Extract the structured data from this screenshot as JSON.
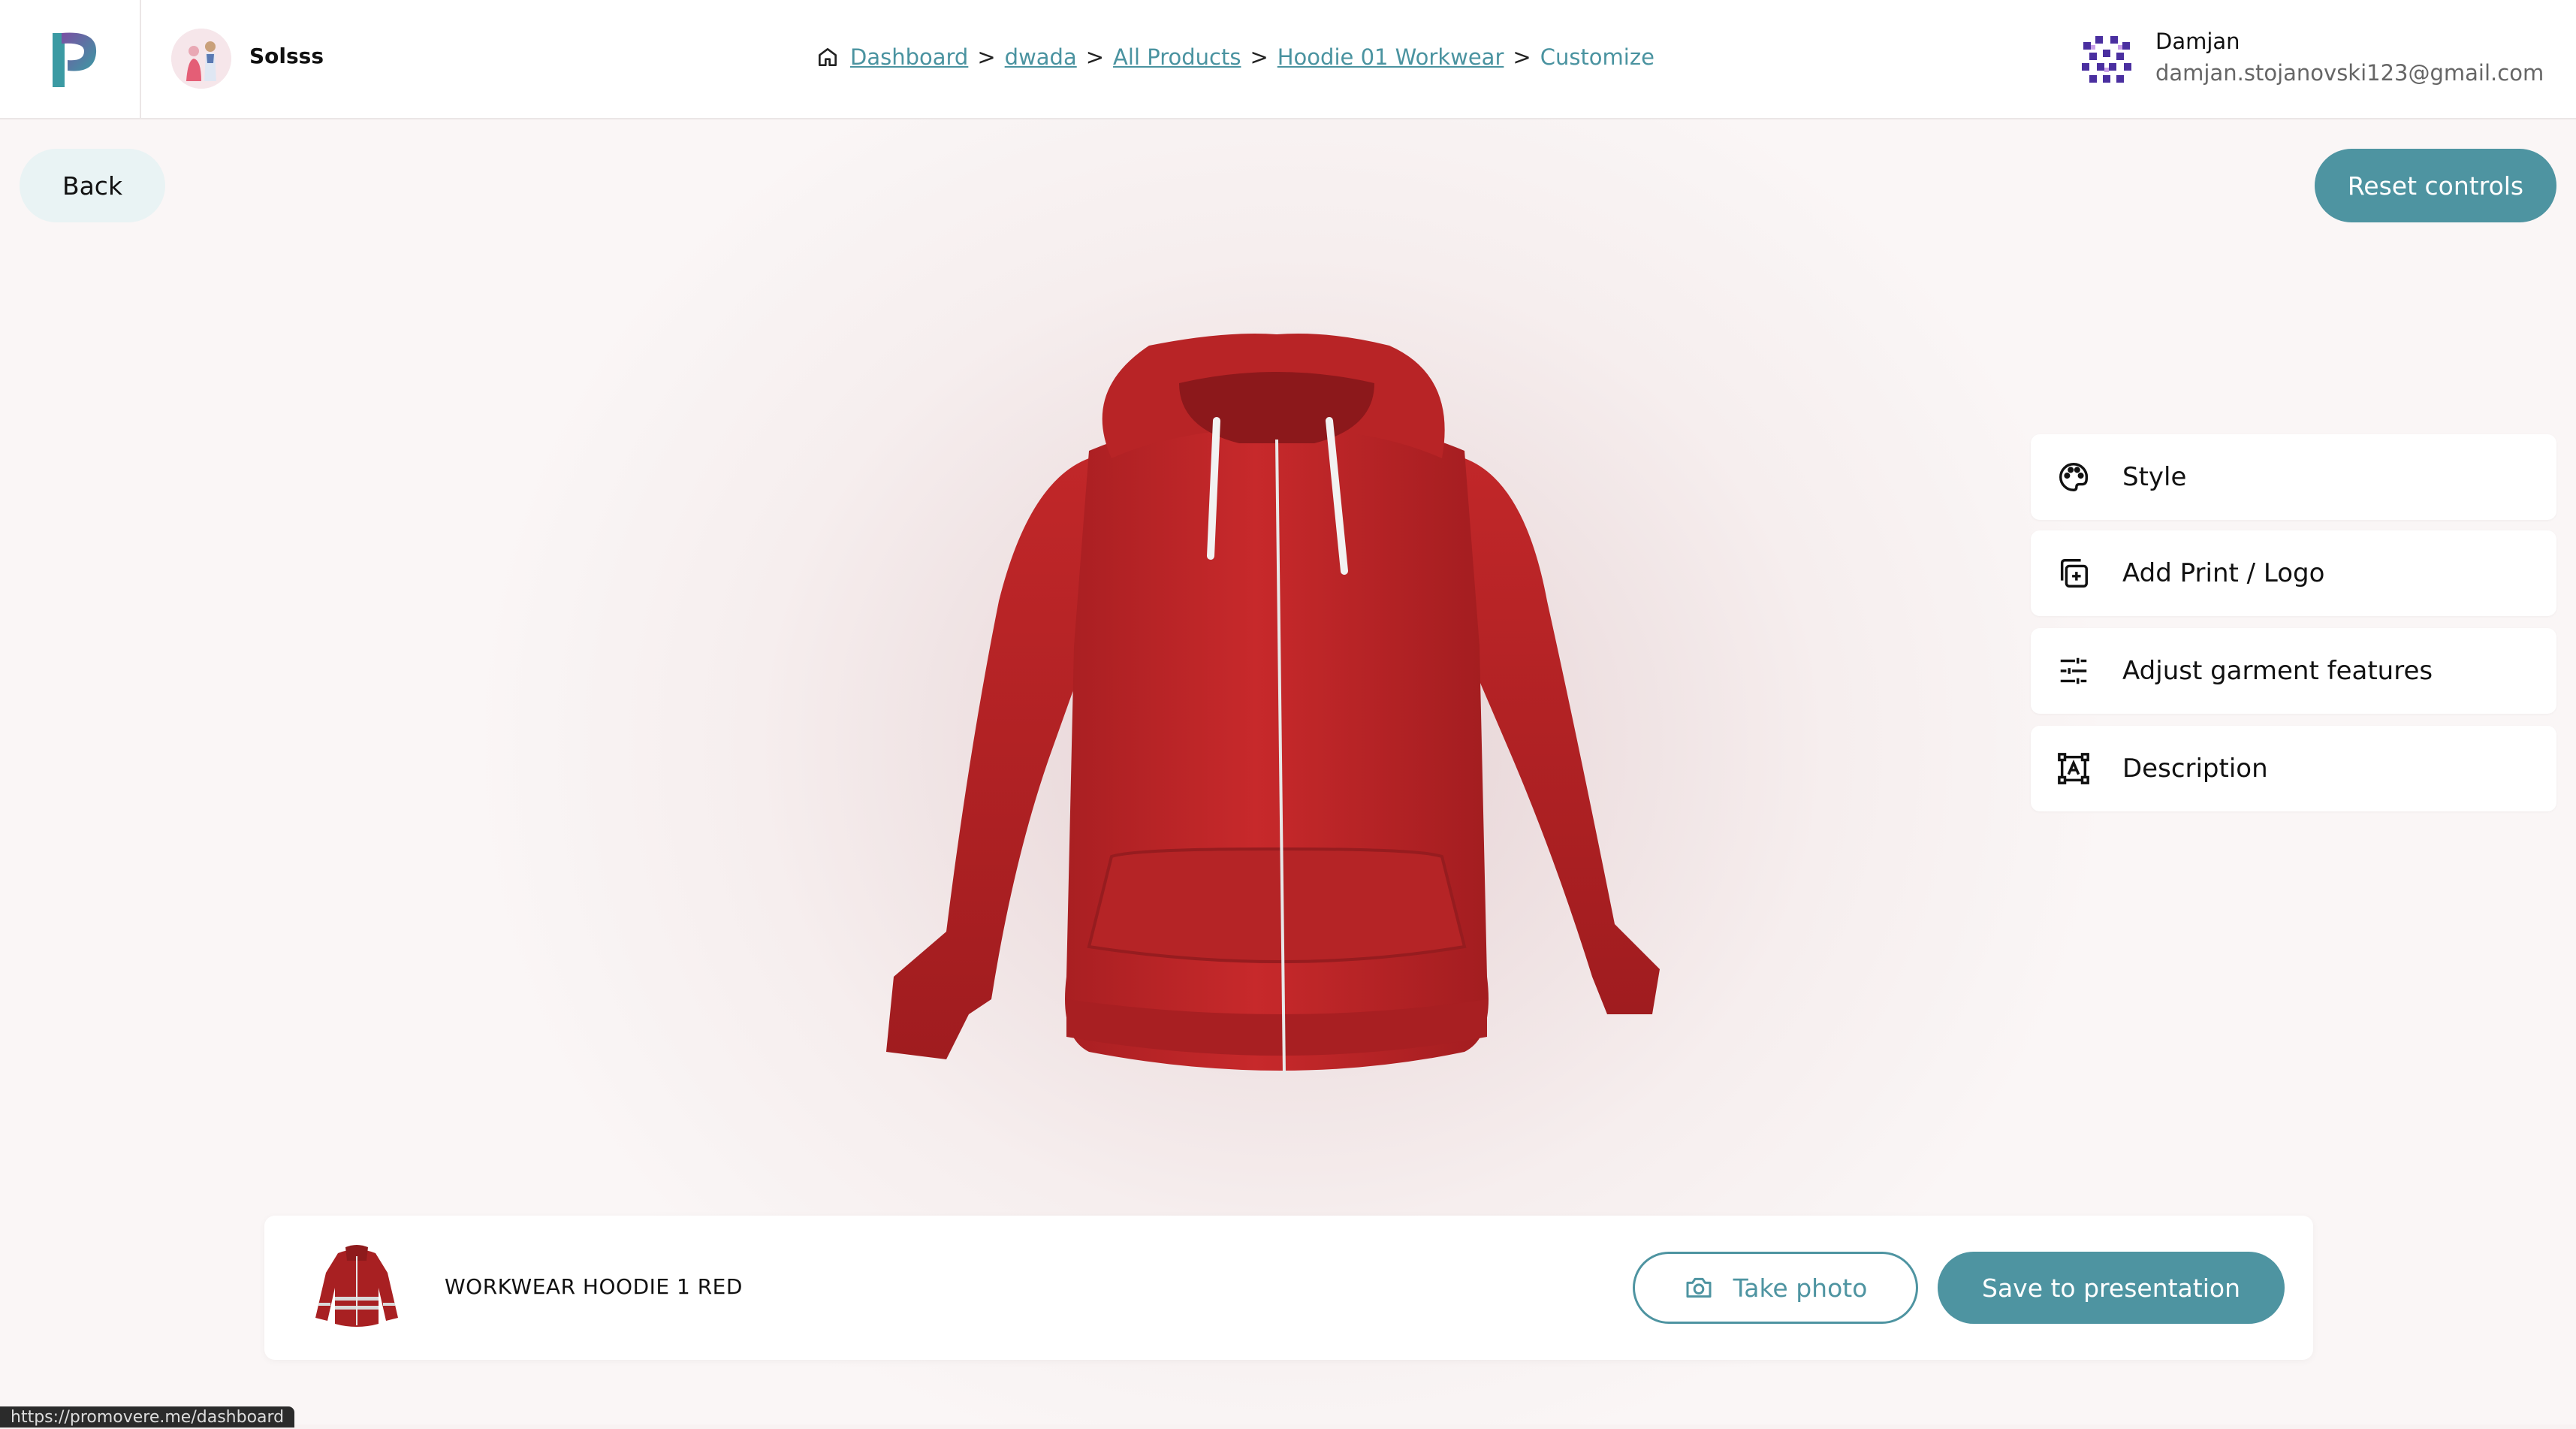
{
  "header": {
    "org_name": "Solsss",
    "breadcrumb": {
      "items": [
        "Dashboard",
        "dwada",
        "All Products",
        "Hoodie 01 Workwear"
      ],
      "current": "Customize",
      "separator": ">"
    },
    "user": {
      "name": "Damjan",
      "email": "damjan.stojanovski123@gmail.com"
    }
  },
  "controls": {
    "back_label": "Back",
    "reset_label": "Reset controls"
  },
  "menu": {
    "items": [
      {
        "label": "Style",
        "icon": "palette-icon"
      },
      {
        "label": "Add Print / Logo",
        "icon": "add-layer-icon"
      },
      {
        "label": "Adjust garment features",
        "icon": "sliders-icon"
      },
      {
        "label": "Description",
        "icon": "text-frame-icon"
      }
    ]
  },
  "product": {
    "name": "WORKWEAR HOODIE 1 RED",
    "color": "#c4282a"
  },
  "actions": {
    "take_photo_label": "Take photo",
    "save_label": "Save to presentation"
  },
  "status_url": "https://promovere.me/dashboard",
  "colors": {
    "accent": "#4e94a1",
    "accent_light": "#e9f3f4"
  }
}
